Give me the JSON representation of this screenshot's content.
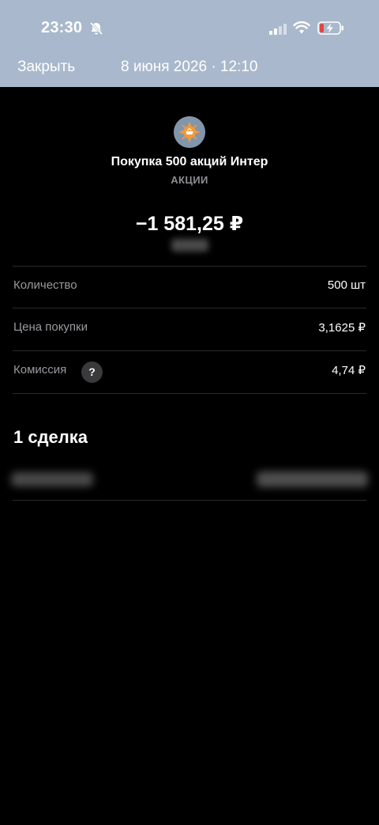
{
  "status_bar": {
    "time": "23:30",
    "icons": [
      "bell-muted-icon",
      "cellular-signal-icon",
      "wifi-icon",
      "battery-charging-icon"
    ]
  },
  "header": {
    "close_label": "Закрыть",
    "datetime": "8 июня 2026 · 12:10"
  },
  "operation": {
    "icon": "company-logo-icon",
    "title": "Покупка 500 акций Интер",
    "category": "АКЦИИ",
    "amount": "−1 581,25 ₽"
  },
  "details": [
    {
      "label": "Количество",
      "value": "500 шт"
    },
    {
      "label": "Цена покупки",
      "value": "3,1625 ₽"
    },
    {
      "label": "Комиссия",
      "value": "4,74 ₽"
    }
  ],
  "help_badge": "?",
  "deals": {
    "title": "1 сделка"
  },
  "colors": {
    "topbar_bg": "#a9b8cc",
    "page_bg": "#000000",
    "muted_text": "#9a9aa0",
    "divider": "#2a2a2c"
  }
}
